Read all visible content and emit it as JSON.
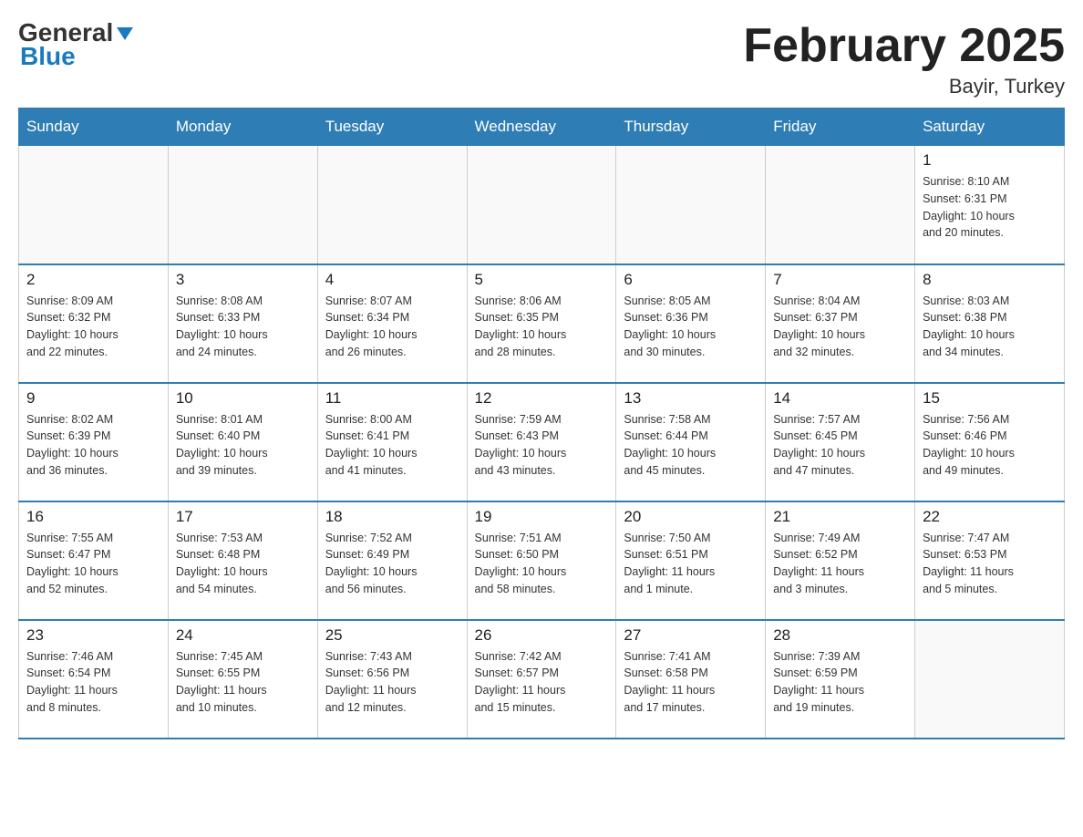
{
  "header": {
    "logo_general": "General",
    "logo_blue": "Blue",
    "title": "February 2025",
    "subtitle": "Bayir, Turkey"
  },
  "weekdays": [
    "Sunday",
    "Monday",
    "Tuesday",
    "Wednesday",
    "Thursday",
    "Friday",
    "Saturday"
  ],
  "weeks": [
    [
      {
        "day": "",
        "info": ""
      },
      {
        "day": "",
        "info": ""
      },
      {
        "day": "",
        "info": ""
      },
      {
        "day": "",
        "info": ""
      },
      {
        "day": "",
        "info": ""
      },
      {
        "day": "",
        "info": ""
      },
      {
        "day": "1",
        "info": "Sunrise: 8:10 AM\nSunset: 6:31 PM\nDaylight: 10 hours\nand 20 minutes."
      }
    ],
    [
      {
        "day": "2",
        "info": "Sunrise: 8:09 AM\nSunset: 6:32 PM\nDaylight: 10 hours\nand 22 minutes."
      },
      {
        "day": "3",
        "info": "Sunrise: 8:08 AM\nSunset: 6:33 PM\nDaylight: 10 hours\nand 24 minutes."
      },
      {
        "day": "4",
        "info": "Sunrise: 8:07 AM\nSunset: 6:34 PM\nDaylight: 10 hours\nand 26 minutes."
      },
      {
        "day": "5",
        "info": "Sunrise: 8:06 AM\nSunset: 6:35 PM\nDaylight: 10 hours\nand 28 minutes."
      },
      {
        "day": "6",
        "info": "Sunrise: 8:05 AM\nSunset: 6:36 PM\nDaylight: 10 hours\nand 30 minutes."
      },
      {
        "day": "7",
        "info": "Sunrise: 8:04 AM\nSunset: 6:37 PM\nDaylight: 10 hours\nand 32 minutes."
      },
      {
        "day": "8",
        "info": "Sunrise: 8:03 AM\nSunset: 6:38 PM\nDaylight: 10 hours\nand 34 minutes."
      }
    ],
    [
      {
        "day": "9",
        "info": "Sunrise: 8:02 AM\nSunset: 6:39 PM\nDaylight: 10 hours\nand 36 minutes."
      },
      {
        "day": "10",
        "info": "Sunrise: 8:01 AM\nSunset: 6:40 PM\nDaylight: 10 hours\nand 39 minutes."
      },
      {
        "day": "11",
        "info": "Sunrise: 8:00 AM\nSunset: 6:41 PM\nDaylight: 10 hours\nand 41 minutes."
      },
      {
        "day": "12",
        "info": "Sunrise: 7:59 AM\nSunset: 6:43 PM\nDaylight: 10 hours\nand 43 minutes."
      },
      {
        "day": "13",
        "info": "Sunrise: 7:58 AM\nSunset: 6:44 PM\nDaylight: 10 hours\nand 45 minutes."
      },
      {
        "day": "14",
        "info": "Sunrise: 7:57 AM\nSunset: 6:45 PM\nDaylight: 10 hours\nand 47 minutes."
      },
      {
        "day": "15",
        "info": "Sunrise: 7:56 AM\nSunset: 6:46 PM\nDaylight: 10 hours\nand 49 minutes."
      }
    ],
    [
      {
        "day": "16",
        "info": "Sunrise: 7:55 AM\nSunset: 6:47 PM\nDaylight: 10 hours\nand 52 minutes."
      },
      {
        "day": "17",
        "info": "Sunrise: 7:53 AM\nSunset: 6:48 PM\nDaylight: 10 hours\nand 54 minutes."
      },
      {
        "day": "18",
        "info": "Sunrise: 7:52 AM\nSunset: 6:49 PM\nDaylight: 10 hours\nand 56 minutes."
      },
      {
        "day": "19",
        "info": "Sunrise: 7:51 AM\nSunset: 6:50 PM\nDaylight: 10 hours\nand 58 minutes."
      },
      {
        "day": "20",
        "info": "Sunrise: 7:50 AM\nSunset: 6:51 PM\nDaylight: 11 hours\nand 1 minute."
      },
      {
        "day": "21",
        "info": "Sunrise: 7:49 AM\nSunset: 6:52 PM\nDaylight: 11 hours\nand 3 minutes."
      },
      {
        "day": "22",
        "info": "Sunrise: 7:47 AM\nSunset: 6:53 PM\nDaylight: 11 hours\nand 5 minutes."
      }
    ],
    [
      {
        "day": "23",
        "info": "Sunrise: 7:46 AM\nSunset: 6:54 PM\nDaylight: 11 hours\nand 8 minutes."
      },
      {
        "day": "24",
        "info": "Sunrise: 7:45 AM\nSunset: 6:55 PM\nDaylight: 11 hours\nand 10 minutes."
      },
      {
        "day": "25",
        "info": "Sunrise: 7:43 AM\nSunset: 6:56 PM\nDaylight: 11 hours\nand 12 minutes."
      },
      {
        "day": "26",
        "info": "Sunrise: 7:42 AM\nSunset: 6:57 PM\nDaylight: 11 hours\nand 15 minutes."
      },
      {
        "day": "27",
        "info": "Sunrise: 7:41 AM\nSunset: 6:58 PM\nDaylight: 11 hours\nand 17 minutes."
      },
      {
        "day": "28",
        "info": "Sunrise: 7:39 AM\nSunset: 6:59 PM\nDaylight: 11 hours\nand 19 minutes."
      },
      {
        "day": "",
        "info": ""
      }
    ]
  ]
}
